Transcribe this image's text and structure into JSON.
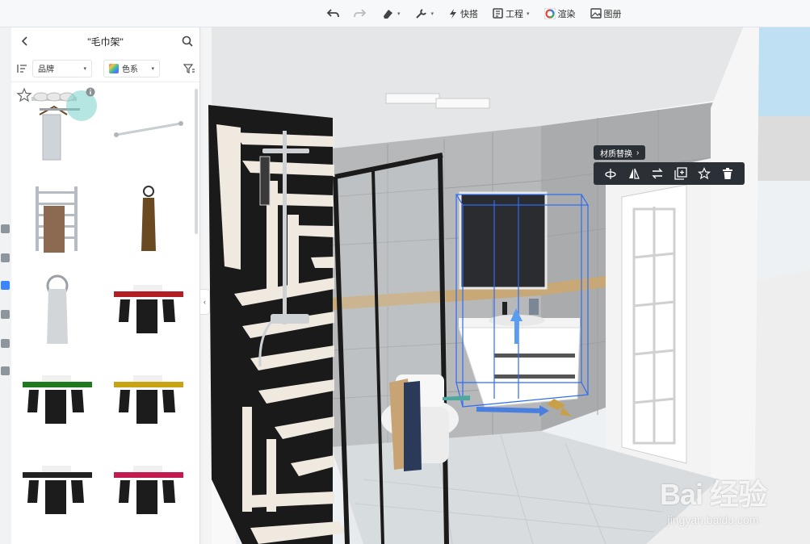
{
  "toolbar": {
    "items": [
      {
        "icon": "undo-icon",
        "label": ""
      },
      {
        "icon": "redo-icon",
        "label": ""
      },
      {
        "icon": "eraser-icon",
        "label": ""
      },
      {
        "icon": "wrench-icon",
        "label": ""
      },
      {
        "icon": "lightning-icon",
        "label": "快搭"
      },
      {
        "icon": "project-icon",
        "label": "工程"
      },
      {
        "icon": "render-icon",
        "label": "渲染"
      },
      {
        "icon": "album-icon",
        "label": "图册"
      }
    ]
  },
  "panel": {
    "title": "\"毛巾架\"",
    "filters": {
      "brand": "品牌",
      "color": "色系"
    },
    "products": [
      {
        "name": "towel-rack-with-shelf",
        "color": "#c9ced3"
      },
      {
        "name": "towel-bar",
        "color": "#c9ced3"
      },
      {
        "name": "heated-towel-rail",
        "color": "#b7bcc2"
      },
      {
        "name": "towel-hook",
        "color": "#6b4a22"
      },
      {
        "name": "towel-ring",
        "color": "#b7bcc2"
      },
      {
        "name": "towel-rack-red",
        "color": "#b31e24"
      },
      {
        "name": "towel-rack-green",
        "color": "#1f7a1f"
      },
      {
        "name": "towel-rack-yellow",
        "color": "#c8a314"
      },
      {
        "name": "towel-rack-black",
        "color": "#222222"
      },
      {
        "name": "towel-rack-magenta",
        "color": "#c21a4f"
      }
    ]
  },
  "floating": {
    "material_label": "材质替换",
    "tools": [
      "rotate-icon",
      "mirror-icon",
      "swap-icon",
      "add-copy-icon",
      "star-icon",
      "trash-icon"
    ]
  },
  "watermark": {
    "logo": "Bai 经验",
    "url": "jingyan.baidu.com"
  }
}
